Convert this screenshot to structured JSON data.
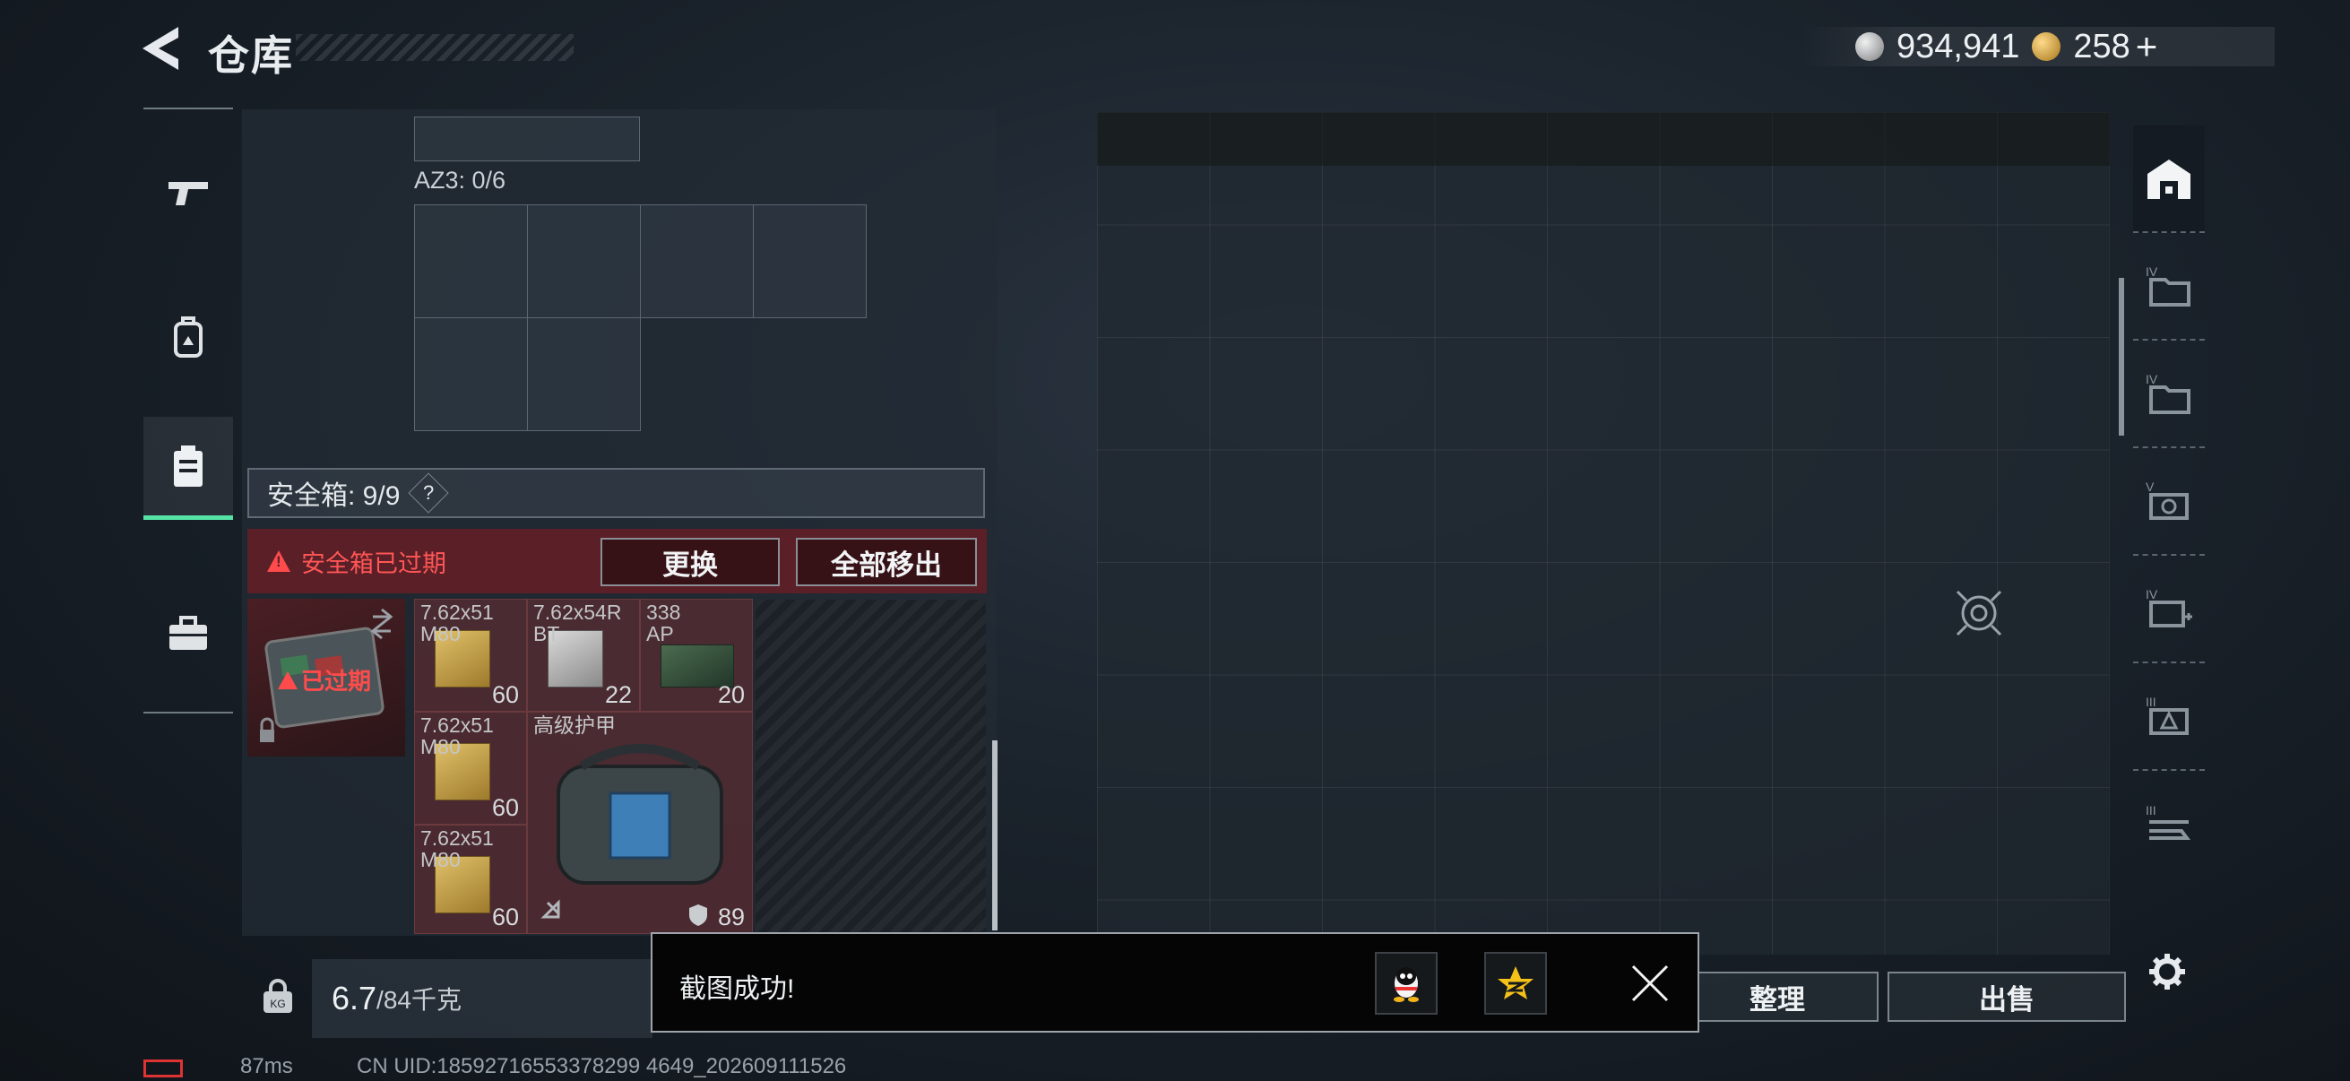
{
  "header": {
    "title": "仓库",
    "silver": "934,941",
    "gold": "258",
    "gold_plus": "+"
  },
  "left_nav": [
    "gun-icon",
    "backpack-icon",
    "safebox-icon",
    "toolbox-icon"
  ],
  "inventory": {
    "az3_label": "AZ3: 0/6",
    "safebox_label": "安全箱: 9/9",
    "help": "?",
    "expired_notice": "安全箱已过期",
    "replace_button": "更换",
    "remove_all_button": "全部移出",
    "case_status": "已过期",
    "items": [
      {
        "name": "7.62x51\nM80",
        "count": "60"
      },
      {
        "name": "7.62x54R\nBT",
        "count": "22"
      },
      {
        "name": "338\nAP",
        "count": "20"
      },
      {
        "name": "7.62x51\nM80",
        "count": "60"
      },
      {
        "name": "高级护甲",
        "count": "89"
      },
      {
        "name": "7.62x51\nM80",
        "count": "60"
      }
    ]
  },
  "weight": {
    "current": "6.7",
    "unit": "/84千克"
  },
  "stash": {
    "sort_button": "整理",
    "sell_button": "出售",
    "right_nav": [
      "stash-icon",
      "iv-folder-icon-1",
      "iv-folder-icon-2",
      "v-gpu-icon",
      "iv-medkit-icon",
      "iii-warning-icon",
      "iii-rack-icon"
    ]
  },
  "toast": {
    "message": "截图成功!"
  },
  "status": {
    "ping": "87ms",
    "uid": "CN UID:18592716553378299 4649_202609111526"
  },
  "colors": {
    "accent": "#56e3a6",
    "danger": "#ff4b4b",
    "expired_bg": "#5a1f27"
  }
}
